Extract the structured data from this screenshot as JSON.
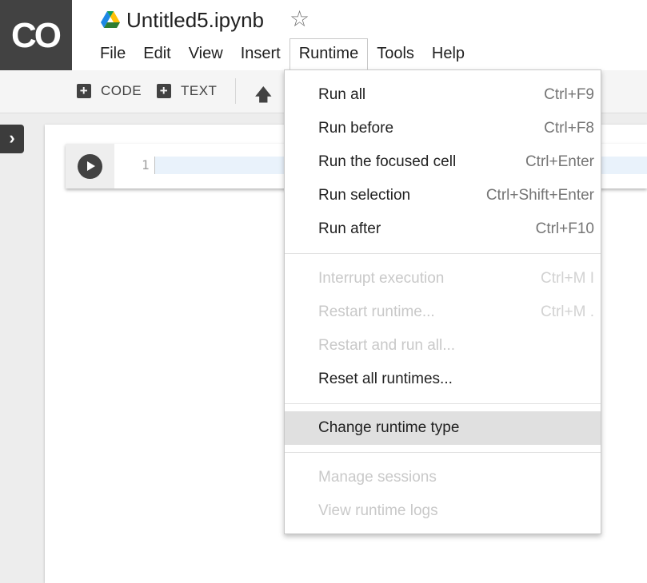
{
  "app": {
    "logo_text": "CO",
    "doc_title": "Untitled5.ipynb"
  },
  "menubar": {
    "items": [
      "File",
      "Edit",
      "View",
      "Insert",
      "Runtime",
      "Tools",
      "Help"
    ],
    "open_menu": "Runtime"
  },
  "toolbar": {
    "code_label": "CODE",
    "text_label": "TEXT"
  },
  "cell": {
    "line_number": "1"
  },
  "runtime_menu": {
    "items": [
      {
        "label": "Run all",
        "shortcut": "Ctrl+F9",
        "enabled": true
      },
      {
        "label": "Run before",
        "shortcut": "Ctrl+F8",
        "enabled": true
      },
      {
        "label": "Run the focused cell",
        "shortcut": "Ctrl+Enter",
        "enabled": true
      },
      {
        "label": "Run selection",
        "shortcut": "Ctrl+Shift+Enter",
        "enabled": true
      },
      {
        "label": "Run after",
        "shortcut": "Ctrl+F10",
        "enabled": true
      },
      {
        "label": "Interrupt execution",
        "shortcut": "Ctrl+M I",
        "enabled": false
      },
      {
        "label": "Restart runtime...",
        "shortcut": "Ctrl+M .",
        "enabled": false
      },
      {
        "label": "Restart and run all...",
        "shortcut": "",
        "enabled": false
      },
      {
        "label": "Reset all runtimes...",
        "shortcut": "",
        "enabled": true
      },
      {
        "label": "Change runtime type",
        "shortcut": "",
        "enabled": true,
        "highlighted": true
      },
      {
        "label": "Manage sessions",
        "shortcut": "",
        "enabled": false
      },
      {
        "label": "View runtime logs",
        "shortcut": "",
        "enabled": false
      }
    ]
  }
}
